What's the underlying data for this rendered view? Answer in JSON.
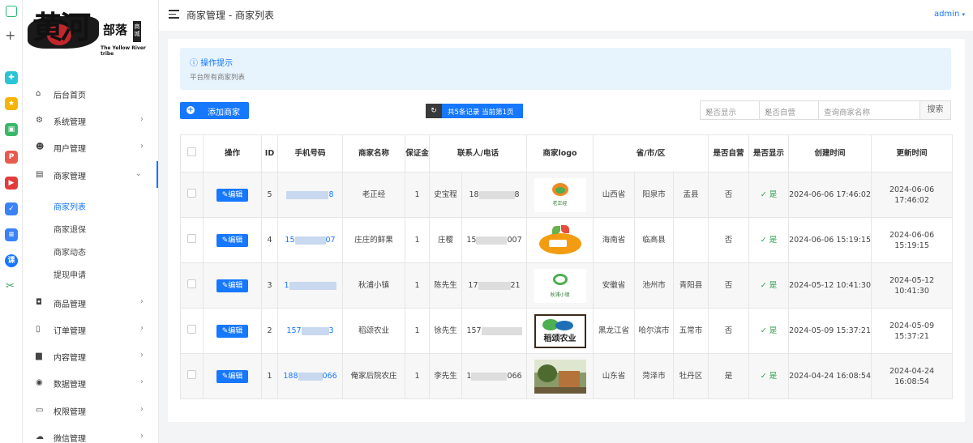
{
  "topbar": {
    "breadcrumb": "商家管理 - 商家列表",
    "user": "admin"
  },
  "brand": {
    "logo_text": "黄河",
    "logo_small": "部落",
    "logo_tag": "商城",
    "logo_sub": "The Yellow River tribe"
  },
  "sidebar": {
    "menu": [
      {
        "label": "后台首页",
        "icon": "home-icon"
      },
      {
        "label": "系统管理",
        "icon": "gear-icon"
      },
      {
        "label": "用户管理",
        "icon": "users-icon"
      },
      {
        "label": "商家管理",
        "icon": "store-icon"
      },
      {
        "label": "商品管理",
        "icon": "bag-icon"
      },
      {
        "label": "订单管理",
        "icon": "clipboard-icon"
      },
      {
        "label": "内容管理",
        "icon": "document-icon"
      },
      {
        "label": "数据管理",
        "icon": "database-icon"
      },
      {
        "label": "权限管理",
        "icon": "monitor-icon"
      },
      {
        "label": "微信管理",
        "icon": "wechat-icon"
      }
    ],
    "submenu": [
      "商家列表",
      "商家退保",
      "商家动态",
      "提现申请"
    ]
  },
  "tip": {
    "title": "操作提示",
    "text": "平台所有商家列表"
  },
  "toolbar": {
    "add_label": "添加商家",
    "pager_text": "共5条记录 当前第1页",
    "filter_show": "是否显示",
    "filter_self": "是否自营",
    "search_placeholder": "查询商家名称",
    "search_button": "搜索"
  },
  "table": {
    "headers": [
      "操作",
      "ID",
      "手机号码",
      "商家名称",
      "保证金",
      "联系人/电话",
      "商家logo",
      "省/市/区",
      "是否自营",
      "是否显示",
      "创建时间",
      "更新时间"
    ],
    "edit_label": "编辑",
    "rows": [
      {
        "id": "5",
        "phone_pre": "",
        "phone_suf": "8",
        "name": "老正经",
        "deposit": "1",
        "contact": "史宝程",
        "tel_pre": "18",
        "tel_suf": "8",
        "logo_text": "老正经",
        "province": "山西省",
        "city": "阳泉市",
        "district": "盂县",
        "self": "否",
        "show": "是",
        "created": "2024-06-06 17:46:02",
        "updated": "2024-06-06 17:46:02"
      },
      {
        "id": "4",
        "phone_pre": "15",
        "phone_suf": "07",
        "name": "庄庄的鲜果",
        "deposit": "1",
        "contact": "庄樱",
        "tel_pre": "15",
        "tel_suf": "007",
        "logo_text": "",
        "province": "海南省",
        "city": "临高县",
        "district": "",
        "self": "否",
        "show": "是",
        "created": "2024-06-06 15:19:15",
        "updated": "2024-06-06 15:19:15"
      },
      {
        "id": "3",
        "phone_pre": "1",
        "phone_suf": "",
        "name": "秋浦小镇",
        "deposit": "1",
        "contact": "陈先生",
        "tel_pre": "17",
        "tel_suf": "21",
        "logo_text": "秋浦小镇",
        "province": "安徽省",
        "city": "池州市",
        "district": "青阳县",
        "self": "否",
        "show": "是",
        "created": "2024-05-12 10:41:30",
        "updated": "2024-05-12 10:41:30"
      },
      {
        "id": "2",
        "phone_pre": "157",
        "phone_suf": "3",
        "name": "稻颂农业",
        "deposit": "1",
        "contact": "徐先生",
        "tel_pre": "157",
        "tel_suf": "",
        "logo_text": "稻颂农业",
        "province": "黑龙江省",
        "city": "哈尔滨市",
        "district": "五常市",
        "self": "否",
        "show": "是",
        "created": "2024-05-09 15:37:21",
        "updated": "2024-05-09 15:37:21"
      },
      {
        "id": "1",
        "phone_pre": "188",
        "phone_suf": "066",
        "name": "俺家后院农庄",
        "deposit": "1",
        "contact": "李先生",
        "tel_pre": "1",
        "tel_suf": "066",
        "logo_text": "",
        "province": "山东省",
        "city": "菏泽市",
        "district": "牡丹区",
        "self": "是",
        "show": "是",
        "created": "2024-04-24 16:08:54",
        "updated": "2024-04-24 16:08:54"
      }
    ]
  },
  "colors": {
    "accent": "#1677ff",
    "success": "#2a9d4b",
    "tip_bg": "#e8f4fd"
  }
}
